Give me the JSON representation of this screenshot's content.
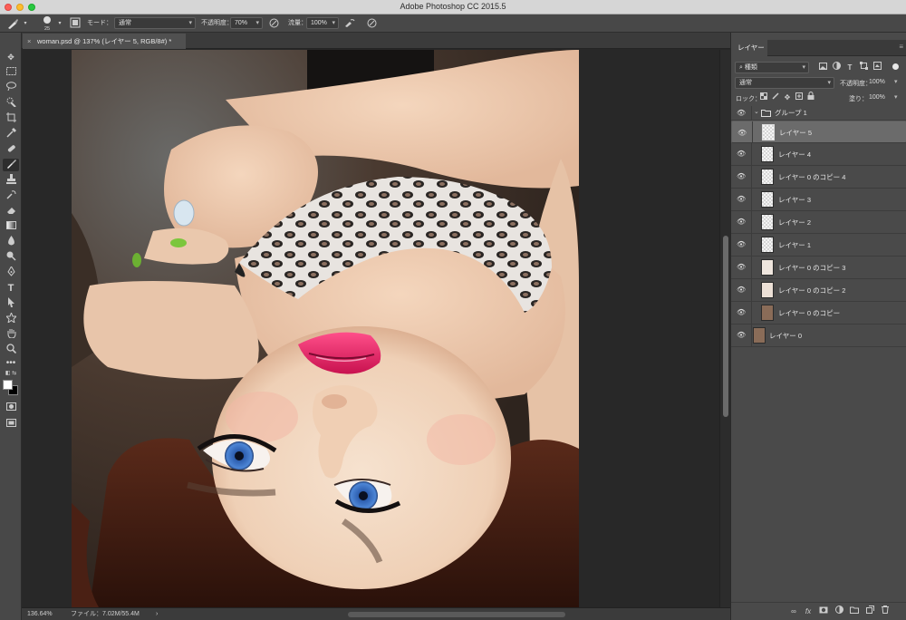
{
  "window": {
    "title": "Adobe Photoshop CC 2015.5"
  },
  "options_bar": {
    "brush_size": "25",
    "mode_label": "モード：",
    "mode_value": "通常",
    "opacity_label": "不透明度：",
    "opacity_value": "70%",
    "flow_label": "流量：",
    "flow_value": "100%"
  },
  "document": {
    "tab_title": "woman.psd @ 137% (レイヤー 5, RGB/8#) *",
    "close_glyph": "×"
  },
  "status": {
    "zoom": "136.64%",
    "file_info": "ファイル：7.02M/55.4M",
    "arrow": "›"
  },
  "layers_panel": {
    "tab_label": "レイヤー",
    "filter_value": "種類",
    "blend_value": "通常",
    "opacity_label": "不透明度：",
    "opacity_value": "100%",
    "lock_label": "ロック：",
    "fill_label": "塗り：",
    "fill_value": "100%",
    "group_name": "グループ 1",
    "layers": [
      {
        "name": "レイヤー 5"
      },
      {
        "name": "レイヤー 4"
      },
      {
        "name": "レイヤー 0 のコピー 4"
      },
      {
        "name": "レイヤー 3"
      },
      {
        "name": "レイヤー 2"
      },
      {
        "name": "レイヤー 1"
      },
      {
        "name": "レイヤー 0 のコピー 3"
      },
      {
        "name": "レイヤー 0 のコピー 2"
      },
      {
        "name": "レイヤー 0 のコピー"
      },
      {
        "name": "レイヤー 0"
      }
    ]
  },
  "colors": {
    "selected_layer": "#6b6b6b",
    "panel_bg": "#4a4a4a",
    "canvas_bg": "#282828"
  }
}
